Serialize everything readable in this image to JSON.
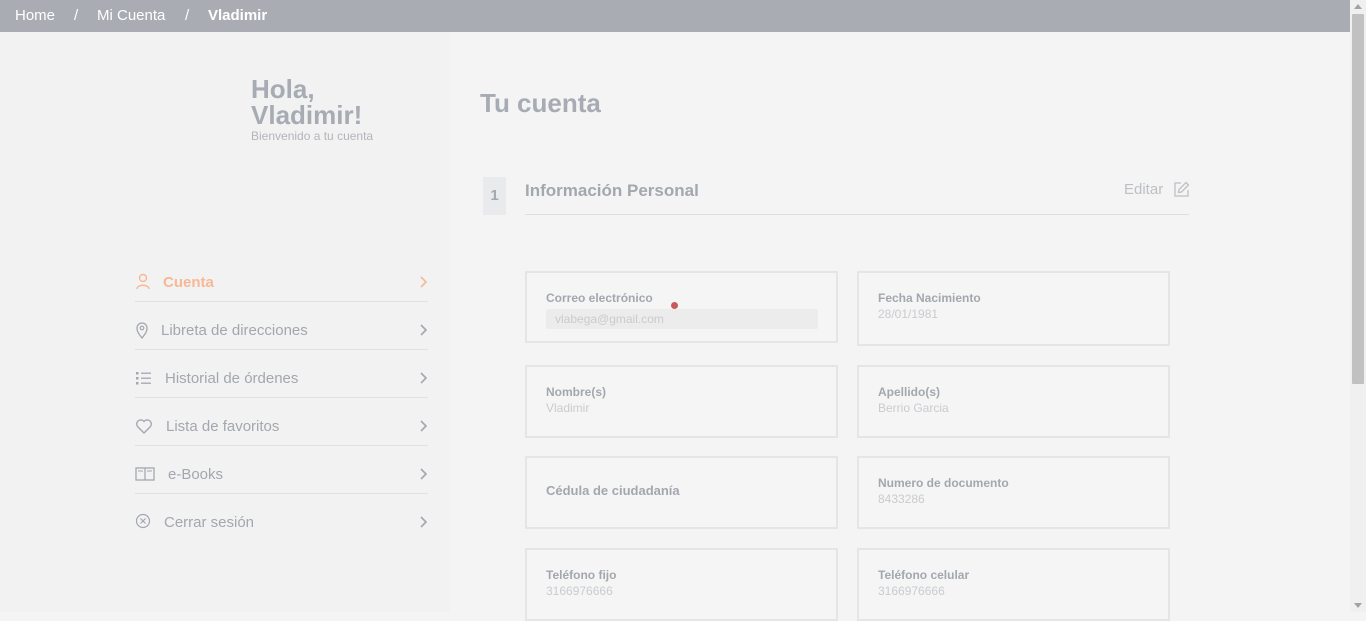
{
  "breadcrumb": {
    "home": "Home",
    "sep1": "/",
    "account": "Mi Cuenta",
    "sep2": "/",
    "current": "Vladimir"
  },
  "sidebar": {
    "greeting_line1": "Hola,",
    "greeting_line2": "Vladimir!",
    "greeting_sub": "Bienvenido a tu cuenta",
    "items": [
      {
        "label": "Cuenta",
        "icon": "user-icon",
        "active": true
      },
      {
        "label": "Libreta de direcciones",
        "icon": "location-pin-icon",
        "active": false
      },
      {
        "label": "Historial de órdenes",
        "icon": "list-icon",
        "active": false
      },
      {
        "label": "Lista de favoritos",
        "icon": "heart-icon",
        "active": false
      },
      {
        "label": "e-Books",
        "icon": "book-icon",
        "active": false
      },
      {
        "label": "Cerrar sesión",
        "icon": "close-circle-icon",
        "active": false
      }
    ]
  },
  "main": {
    "title": "Tu cuenta",
    "step_number": "1",
    "section_title": "Información Personal",
    "edit_label": "Editar",
    "fields": {
      "email": {
        "label": "Correo electrónico",
        "value": "vlabega@gmail.com"
      },
      "birth": {
        "label": "Fecha Nacimiento",
        "value": "28/01/1981"
      },
      "names": {
        "label": "Nombre(s)",
        "value": "Vladimir"
      },
      "surnames": {
        "label": "Apellido(s)",
        "value": "Berrio Garcia"
      },
      "doc_type": {
        "label": "Cédula de ciudadanía",
        "value": ""
      },
      "doc_number": {
        "label": "Numero de documento",
        "value": "8433286"
      },
      "phone": {
        "label": "Teléfono fijo",
        "value": "3166976666"
      },
      "mobile": {
        "label": "Teléfono celular",
        "value": "3166976666"
      }
    }
  },
  "colors": {
    "accent": "#f6b895",
    "text_muted": "#a3a7ae",
    "header_bg": "#a9acb3"
  }
}
